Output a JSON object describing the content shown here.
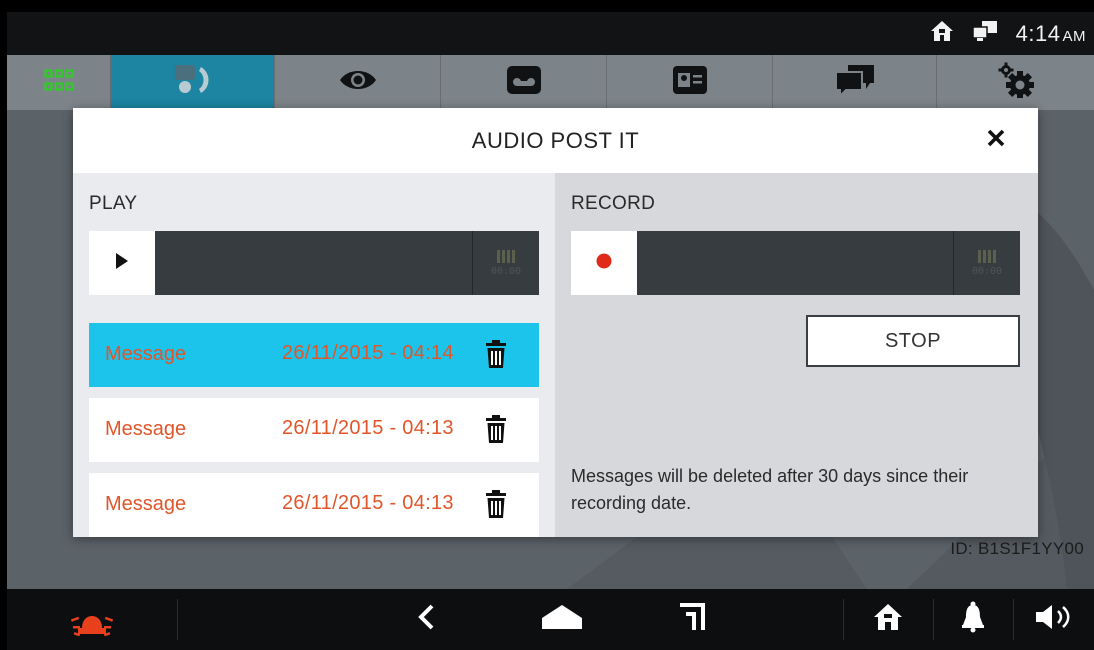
{
  "status": {
    "time": "4:14",
    "ampm": "AM",
    "icons": [
      "home-status-icon",
      "network-icon"
    ]
  },
  "topnav": {
    "items": [
      {
        "name": "apps-grid-icon"
      },
      {
        "name": "intercom-call-icon",
        "active": true
      },
      {
        "name": "eye-icon"
      },
      {
        "name": "voicemail-icon"
      },
      {
        "name": "contact-card-icon"
      },
      {
        "name": "messages-icon"
      },
      {
        "name": "settings-icon"
      }
    ]
  },
  "modal": {
    "title": "AUDIO POST IT",
    "close_icon": "close-icon",
    "play": {
      "label": "PLAY",
      "counter": "00:00"
    },
    "record": {
      "label": "RECORD",
      "counter": "00:00",
      "stop_label": "STOP"
    },
    "messages": [
      {
        "name": "Message",
        "date": "26/11/2015 - 04:14",
        "selected": true
      },
      {
        "name": "Message",
        "date": "26/11/2015 - 04:13",
        "selected": false
      },
      {
        "name": "Message",
        "date": "26/11/2015 - 04:13",
        "selected": false
      }
    ],
    "note": "Messages will be deleted after 30 days since their recording date."
  },
  "device_id": "ID: B1S1F1YY00",
  "bottomnav": {
    "items": [
      "alarm-icon",
      "back-icon",
      "home-shape-icon",
      "recents-icon",
      "home-icon",
      "bell-icon",
      "volume-icon"
    ]
  },
  "colors": {
    "accent_blue": "#1cc4ec",
    "active_tab": "#1d84a1",
    "message_text": "#e0562a",
    "record_dot": "#e02a1a",
    "alarm": "#e8401c",
    "grid_green": "#35c62f"
  }
}
